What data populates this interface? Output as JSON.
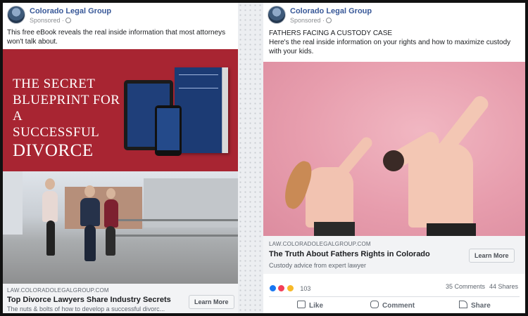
{
  "left_ad": {
    "page_name": "Colorado Legal Group",
    "sponsored": "Sponsored ·",
    "body_text": "This free eBook reveals the real inside information that most attorneys won't talk about.",
    "banner": {
      "line1": "THE SECRET",
      "line2": "BLUEPRINT FOR A",
      "line3": "SUCCESSFUL",
      "line4": "DIVORCE"
    },
    "domain": "LAW.COLORADOLEGALGROUP.COM",
    "headline": "Top Divorce Lawyers Share Industry Secrets",
    "description": "The nuts & bolts of how to develop a successful divorc...",
    "cta": "Learn More"
  },
  "right_ad": {
    "page_name": "Colorado Legal Group",
    "sponsored": "Sponsored ·",
    "body_line1": "FATHERS FACING A CUSTODY CASE",
    "body_line2": "Here's the real inside information on your rights and how to maximize custody with your kids.",
    "domain": "LAW.COLORADOLEGALGROUP.COM",
    "headline": "The Truth About Fathers Rights in Colorado",
    "description": "Custody advice from expert lawyer",
    "cta": "Learn More",
    "reaction_count": "103",
    "comments": "35 Comments",
    "shares": "44 Shares",
    "actions": {
      "like": "Like",
      "comment": "Comment",
      "share": "Share"
    }
  },
  "colors": {
    "link_blue": "#385898",
    "banner_red": "#a82532",
    "photo_pink": "#e79dad",
    "like_blue": "#1877f2",
    "love_red": "#f33e58",
    "haha_yellow": "#f7b928"
  },
  "icons": {
    "avatar": "page-avatar",
    "privacy": "globe-icon",
    "like": "thumbs-up-icon",
    "comment": "comment-bubble-icon",
    "share": "share-arrow-icon"
  }
}
